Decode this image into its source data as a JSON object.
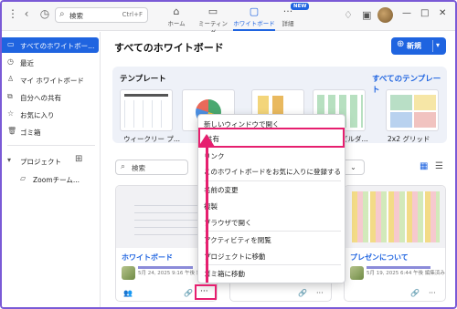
{
  "topbar": {
    "search_placeholder": "検索",
    "search_shortcut": "Ctrl+F",
    "tabs": [
      {
        "label": "ホーム",
        "icon": "home-icon"
      },
      {
        "label": "ミーティング",
        "icon": "video-camera-icon"
      },
      {
        "label": "ホワイトボード",
        "icon": "whiteboard-icon"
      },
      {
        "label": "詳細",
        "icon": "more-icon"
      }
    ],
    "new_badge": "NEW",
    "active_tab": "ホワイトボード"
  },
  "sidebar": {
    "items": [
      {
        "label": "すべてのホワイトボー...",
        "icon": "whiteboard-icon"
      },
      {
        "label": "最近",
        "icon": "clock-icon"
      },
      {
        "label": "マイ ホワイトボード",
        "icon": "person-icon"
      },
      {
        "label": "自分への共有",
        "icon": "share-icon"
      },
      {
        "label": "お気に入り",
        "icon": "star-icon"
      },
      {
        "label": "ゴミ箱",
        "icon": "trash-icon"
      }
    ],
    "project_label": "プロジェクト",
    "project_item": "Zoomチーム..."
  },
  "main": {
    "title": "すべてのホワイトボード",
    "new_button": "新規",
    "templates_title": "テンプレート",
    "templates_all": "すべてのテンプレート",
    "templates": [
      {
        "label": "ウィークリー プ..."
      },
      {
        "label": ""
      },
      {
        "label": ""
      },
      {
        "label": "ビルダ..."
      },
      {
        "label": "2x2 グリッド"
      }
    ],
    "filter_placeholder": "検索",
    "boards": [
      {
        "name": "ホワイトボード",
        "meta": "5月 24, 2025 9:16 午後 編集済み"
      },
      {
        "name": "",
        "meta": ""
      },
      {
        "name": "プレゼンについて",
        "meta": "5月 19, 2025 6:44 午後 編集済み"
      }
    ]
  },
  "context_menu": {
    "items": [
      "新しいウィンドウで開く",
      "共有",
      "リンク",
      "このホワイトボードをお気に入りに登録する",
      "名前の変更",
      "複製",
      "ブラウザで開く",
      "アクティビティを閲覧",
      "プロジェクトに移動",
      "ゴミ箱に移動"
    ],
    "highlighted": "共有"
  },
  "colors": {
    "accent": "#1f64e0",
    "highlight": "#e61f6f"
  }
}
